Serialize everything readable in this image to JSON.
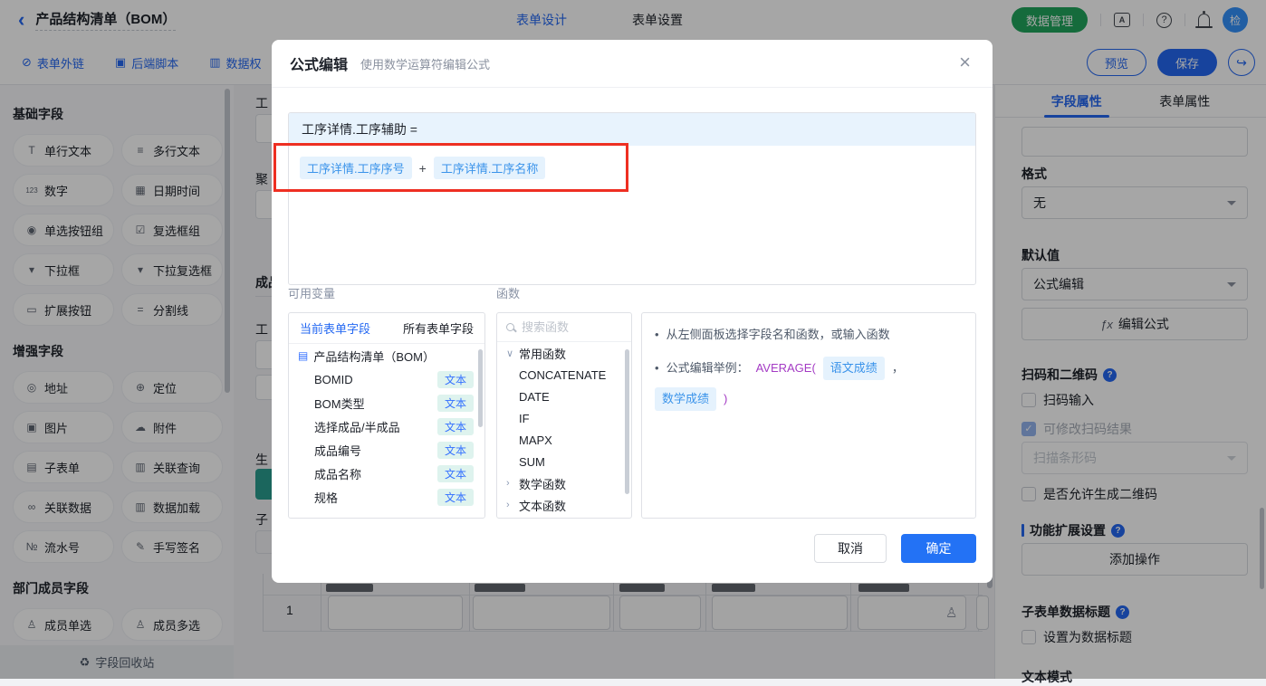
{
  "icons": {
    "back": "‹",
    "external_link": "⊘",
    "script": "▣",
    "data_perm": "▥",
    "address_book": "A",
    "share": "↪",
    "close": "×",
    "doc": "▤",
    "chevron_down": "∨",
    "chevron_right": "›",
    "fx": "ƒx",
    "question_mark": "?",
    "recycle": "♻",
    "check": "✓",
    "person": "♙",
    "plus": "+"
  },
  "colors": {
    "primary": "#2468f2",
    "green": "#21a55c",
    "teal": "#2a9d8f",
    "annotation_red": "#ee2f22",
    "chip_text": "#3a93ea",
    "badge_text": "#3370ff"
  },
  "topbar": {
    "title": "产品结构清单（BOM）",
    "tabs": [
      "表单设计",
      "表单设置"
    ],
    "data_manage": "数据管理",
    "avatar": "检"
  },
  "toolbar": {
    "links": [
      {
        "icon": "⊘",
        "label": "表单外链"
      },
      {
        "icon": "▣",
        "label": "后端脚本"
      },
      {
        "icon": "▥",
        "label": "数据权"
      }
    ],
    "preview": "预览",
    "save": "保存"
  },
  "sidebar": {
    "sections": [
      {
        "title": "基础字段",
        "items": [
          {
            "icon": "T",
            "label": "单行文本"
          },
          {
            "icon": "≡",
            "label": "多行文本"
          },
          {
            "icon": "123",
            "label": "数字"
          },
          {
            "icon": "▦",
            "label": "日期时间"
          },
          {
            "icon": "◉",
            "label": "单选按钮组"
          },
          {
            "icon": "☑",
            "label": "复选框组"
          },
          {
            "icon": "▾",
            "label": "下拉框"
          },
          {
            "icon": "▾",
            "label": "下拉复选框"
          },
          {
            "icon": "▭",
            "label": "扩展按钮"
          },
          {
            "icon": "=",
            "label": "分割线"
          }
        ]
      },
      {
        "title": "增强字段",
        "items": [
          {
            "icon": "◎",
            "label": "地址"
          },
          {
            "icon": "⊕",
            "label": "定位"
          },
          {
            "icon": "▣",
            "label": "图片"
          },
          {
            "icon": "☁",
            "label": "附件"
          },
          {
            "icon": "▤",
            "label": "子表单"
          },
          {
            "icon": "▥",
            "label": "关联查询"
          },
          {
            "icon": "∞",
            "label": "关联数据"
          },
          {
            "icon": "▥",
            "label": "数据加载"
          },
          {
            "icon": "№",
            "label": "流水号"
          },
          {
            "icon": "✎",
            "label": "手写签名"
          }
        ]
      },
      {
        "title": "部门成员字段",
        "items": [
          {
            "icon": "♙",
            "label": "成员单选"
          },
          {
            "icon": "♙",
            "label": "成员多选"
          }
        ]
      }
    ],
    "recycle": "字段回收站"
  },
  "canvas": {
    "fragments": [
      "工",
      "聚",
      "成品",
      "工",
      "生",
      "子"
    ],
    "row_number": "1"
  },
  "modal": {
    "title": "公式编辑",
    "subtitle": "使用数学运算符编辑公式",
    "formula": {
      "target": "工序详情.工序辅助 =",
      "chip1": "工序详情.工序序号",
      "operator": "+",
      "chip2": "工序详情.工序名称"
    },
    "variables": {
      "label": "可用变量",
      "tabs": [
        "当前表单字段",
        "所有表单字段"
      ],
      "form_name": "产品结构清单（BOM）",
      "fields": [
        {
          "name": "BOMID",
          "type": "文本"
        },
        {
          "name": "BOM类型",
          "type": "文本"
        },
        {
          "name": "选择成品/半成品",
          "type": "文本"
        },
        {
          "name": "成品编号",
          "type": "文本"
        },
        {
          "name": "成品名称",
          "type": "文本"
        },
        {
          "name": "规格",
          "type": "文本"
        }
      ]
    },
    "functions": {
      "label": "函数",
      "search_placeholder": "搜索函数",
      "group_expanded": "常用函数",
      "items": [
        "CONCATENATE",
        "DATE",
        "IF",
        "MAPX",
        "SUM"
      ],
      "group_collapsed": [
        "数学函数",
        "文本函数"
      ]
    },
    "help": {
      "tip1": "从左侧面板选择字段名和函数，或输入函数",
      "tip2_prefix": "公式编辑举例：",
      "fn_open": "AVERAGE(",
      "arg1": "语文成绩",
      "comma": "，",
      "arg2": "数学成绩",
      "fn_close": ")"
    },
    "cancel": "取消",
    "ok": "确定"
  },
  "properties": {
    "tabs": [
      "字段属性",
      "表单属性"
    ],
    "format_label": "格式",
    "format_value": "无",
    "default_label": "默认值",
    "default_value": "公式编辑",
    "edit_formula": "编辑公式",
    "scan_section": "扫码和二维码",
    "scan_input": "扫码输入",
    "scan_editable": "可修改扫码结果",
    "scan_mode": "扫描条形码",
    "allow_qr": "是否允许生成二维码",
    "ext_section": "功能扩展设置",
    "add_action": "添加操作",
    "subform_title_section": "子表单数据标题",
    "set_as_title": "设置为数据标题",
    "text_mode": "文本模式"
  }
}
